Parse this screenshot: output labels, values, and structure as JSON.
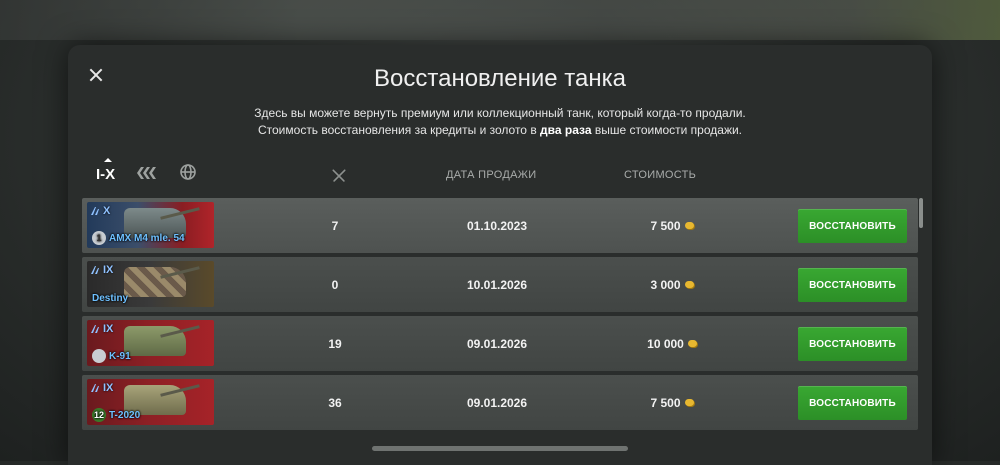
{
  "dialog": {
    "title": "Восстановление танка",
    "subtitle_line1": "Здесь вы можете вернуть премиум или коллекционный танк, который когда-то продали.",
    "subtitle_line2_pre": "Стоимость восстановления за кредиты и золото в ",
    "subtitle_line2_bold": "два раза",
    "subtitle_line2_post": " выше стоимости продажи."
  },
  "filters": {
    "tier_label": "I-X"
  },
  "columns": {
    "date": "ДАТА ПРОДАЖИ",
    "cost": "СТОИМОСТЬ"
  },
  "rows": [
    {
      "tier": "X",
      "name": "AMX M4 mle. 54",
      "mastery": "1",
      "battles": "7",
      "date": "01.10.2023",
      "cost": "7 500",
      "button": "ВОССТАНОВИТЬ"
    },
    {
      "tier": "IX",
      "name": "Destiny",
      "mastery": "",
      "battles": "0",
      "date": "10.01.2026",
      "cost": "3 000",
      "button": "ВОССТАНОВИТЬ"
    },
    {
      "tier": "IX",
      "name": "K-91",
      "mastery": "",
      "battles": "19",
      "date": "09.01.2026",
      "cost": "10 000",
      "button": "ВОССТАНОВИТЬ"
    },
    {
      "tier": "IX",
      "name": "T-2020",
      "mastery": "12",
      "battles": "36",
      "date": "09.01.2026",
      "cost": "7 500",
      "button": "ВОССТАНОВИТЬ"
    }
  ],
  "colors": {
    "accent_green": "#39a832",
    "tier_blue": "#8fc1ff",
    "coin_gold": "#e8b830"
  }
}
